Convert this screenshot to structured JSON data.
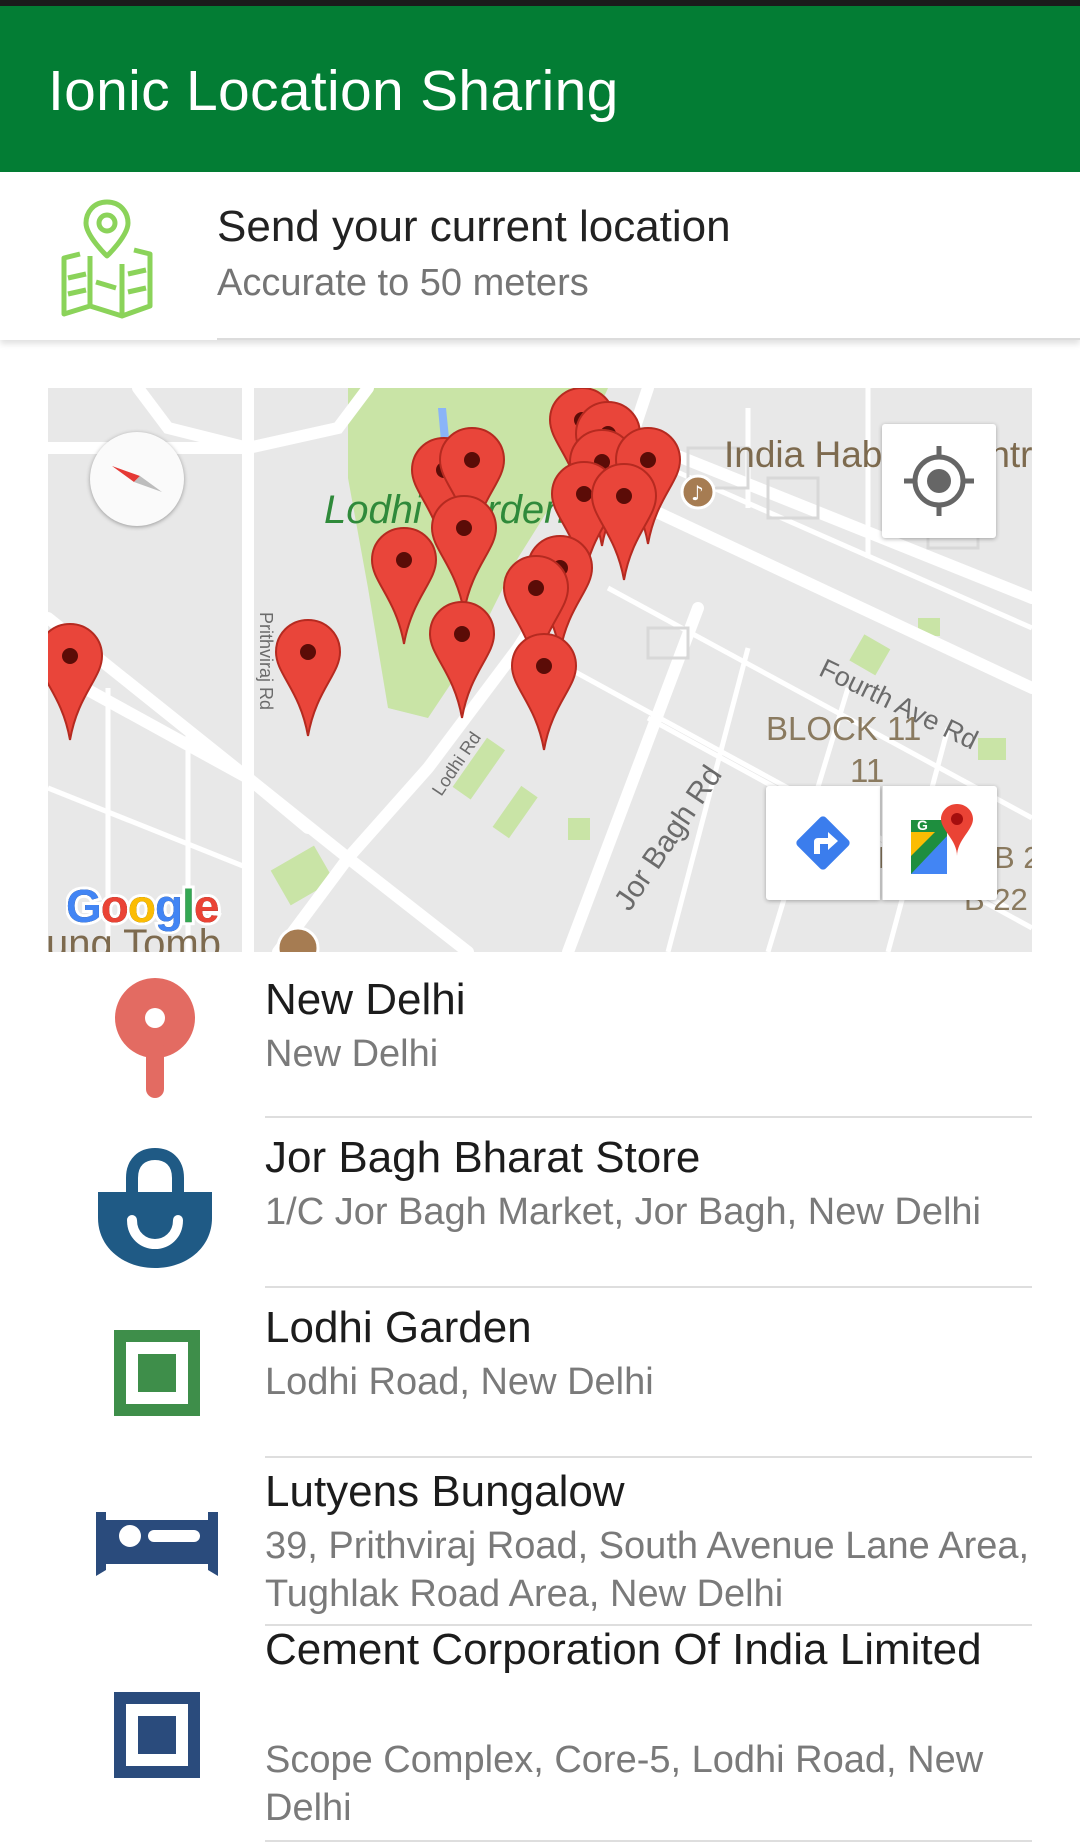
{
  "app_bar": {
    "title": "Ionic Location Sharing",
    "color": "#037d34"
  },
  "send_location": {
    "title": "Send your current location",
    "subtitle": "Accurate to 50 meters",
    "icon": "map-pin-icon"
  },
  "map": {
    "labels": {
      "habitat": "India Habitat Centr",
      "lodhi_garden": "Lodhi Garden",
      "fourth_ave": "Fourth Ave Rd",
      "block": "BLOCK 11",
      "block2": "11",
      "jor_bagh_rd": "Jor Bagh Rd",
      "lodhi_rd": "Lodhi Rd",
      "prithviraj": "Prithviraj Rd",
      "b22": "B 22",
      "b2": "B 2",
      "bl": "BL",
      "tomb": "ung Tomb"
    },
    "logo": "Google",
    "controls": {
      "compass": "compass-icon",
      "locate": "my-location-icon",
      "directions": "directions-icon",
      "open_maps": "google-maps-icon"
    }
  },
  "places": [
    {
      "name": "New Delhi",
      "address": "New Delhi",
      "icon": "red-pin-icon"
    },
    {
      "name": "Jor Bagh Bharat Store",
      "address": "1/C Jor Bagh Market, Jor Bagh, New Delhi",
      "icon": "shopping-bag-icon"
    },
    {
      "name": "Lodhi Garden",
      "address": "Lodhi Road, New Delhi",
      "icon": "park-icon"
    },
    {
      "name": "Lutyens Bungalow",
      "address": "39, Prithviraj Road, South Avenue Lane Area, Tughlak Road Area, New Delhi",
      "icon": "bed-icon"
    },
    {
      "name": "Cement Corporation Of India Limited",
      "address": "Scope Complex, Core-5, Lodhi Road, New Delhi",
      "icon": "building-icon"
    }
  ]
}
